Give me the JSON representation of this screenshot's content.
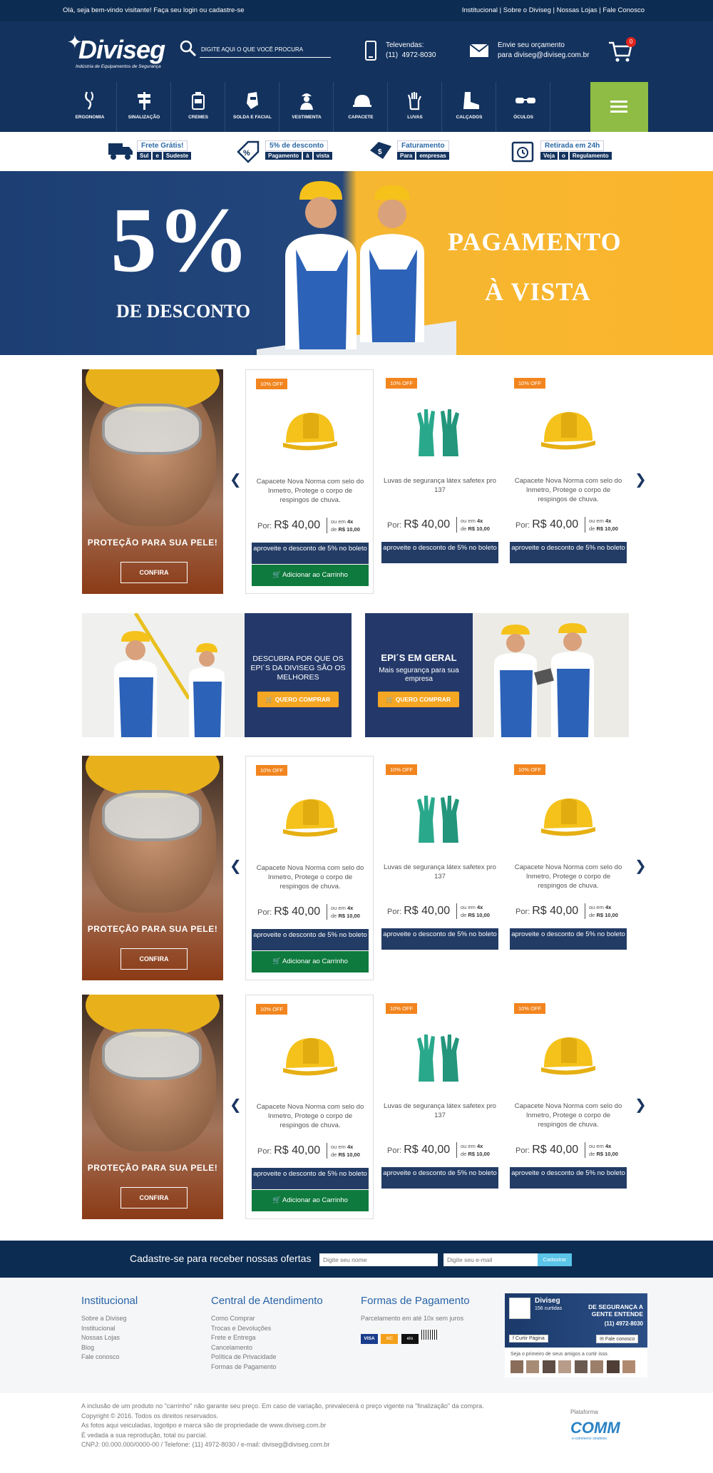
{
  "topbar": {
    "welcome": "Olá, seja bem-vindo visitante! Faça seu login ou cadastre-se",
    "links": "Institucional | Sobre o Diviseg | Nossas Lojas | Fale Conosco"
  },
  "header": {
    "brand": "Diviseg",
    "tagline": "Indústria de Equipamentos de Segurança",
    "search_placeholder": "DIGITE AQUI O QUE VOCÊ PROCURA",
    "phone_label": "Televendas:",
    "phone": "(11)  4972-8030",
    "quote_label": "Envie seu orçamento",
    "quote_email": "para diviseg@diviseg.com.br",
    "cart_count": "0",
    "icons": {
      "search": "search-icon",
      "phone": "phone-icon",
      "mail": "envelope-icon",
      "cart": "cart-icon"
    }
  },
  "categories": [
    {
      "label": "ERGONOMIA",
      "icon": "ergonomia-icon"
    },
    {
      "label": "SINALIZAÇÃO",
      "icon": "signpost-icon"
    },
    {
      "label": "CREMES",
      "icon": "cream-icon"
    },
    {
      "label": "SOLDA E FACIAL",
      "icon": "welding-mask-icon"
    },
    {
      "label": "VESTIMENTA",
      "icon": "worker-icon"
    },
    {
      "label": "CAPACETE",
      "icon": "helmet-icon"
    },
    {
      "label": "LUVAS",
      "icon": "glove-icon"
    },
    {
      "label": "CALÇADOS",
      "icon": "boot-icon"
    },
    {
      "label": "ÓCULOS",
      "icon": "glasses-icon"
    }
  ],
  "perks": [
    {
      "title": "Frete Grátis!",
      "tags": [
        "Sul",
        "e",
        "Sudeste"
      ],
      "icon": "truck-icon"
    },
    {
      "title": "5% de desconto",
      "tags": [
        "Pagamento",
        "à",
        "vista"
      ],
      "icon": "discount-tag-icon"
    },
    {
      "title": "Faturamento",
      "tags": [
        "Para",
        "empresas"
      ],
      "icon": "invoice-icon"
    },
    {
      "title": "Retirada em 24h",
      "tags": [
        "Veja",
        "o",
        "Regulamento"
      ],
      "icon": "calendar-clock-icon"
    }
  ],
  "hero": {
    "percent": "5%",
    "discount": "DE DESCONTO",
    "line1": "PAGAMENTO",
    "line2": "À VISTA",
    "colors": {
      "left": "#1c3e73",
      "right": "#fbb52d"
    }
  },
  "promo": {
    "title": "PROTEÇÃO PARA SUA PELE!",
    "button": "CONFIRA"
  },
  "products": [
    {
      "badge": "10% OFF",
      "name": "Capacete Nova Norma com selo do Inmetro, Protege o corpo de respingos de chuva.",
      "price_label": "Por:",
      "price": "R$ 40,00",
      "inst1": "ou em",
      "inst_n": "4x",
      "inst2": "de",
      "inst_val": "R$ 10,00",
      "boleto": "aproveite o desconto de 5% no boleto",
      "add": "Adicionar ao Carrinho",
      "image": "helmet-icon"
    },
    {
      "badge": "10% OFF",
      "name": "Luvas de segurança látex safetex pro 137",
      "price_label": "Por:",
      "price": "R$ 40,00",
      "inst1": "ou em",
      "inst_n": "4x",
      "inst2": "de",
      "inst_val": "R$ 10,00",
      "boleto": "aproveite o desconto de 5% no boleto",
      "image": "glove-icon"
    },
    {
      "badge": "10% OFF",
      "name": "Capacete Nova Norma com selo do Inmetro, Protege o corpo de respingos de chuva.",
      "price_label": "Por:",
      "price": "R$ 40,00",
      "inst1": "ou em",
      "inst_n": "4x",
      "inst2": "de",
      "inst_val": "R$ 10,00",
      "boleto": "aproveite o desconto de 5% no boleto",
      "image": "helmet-icon"
    }
  ],
  "banner2": {
    "left_text": "DESCUBRA POR QUE OS EPI´S DA DIVISEG SÃO OS MELHORES",
    "left_btn": "QUERO COMPRAR",
    "right_title": "EPI´S EM GERAL",
    "right_sub": "Mais segurança para sua empresa",
    "right_btn": "QUERO COMPRAR"
  },
  "newsletter": {
    "title": "Cadastre-se para receber nossas ofertas",
    "name_placeholder": "Digite seu nome",
    "email_placeholder": "Digite seu e-mail",
    "button": "Cadastrar"
  },
  "footer": {
    "institucional": {
      "title": "Institucional",
      "items": [
        "Sobre a Diviseg",
        "Institucional",
        "Nossas Lojas",
        "Blog",
        "Fale conosco"
      ]
    },
    "atendimento": {
      "title": "Central de Atendimento",
      "items": [
        "Como Comprar",
        "Trocas e Devoluções",
        "Frete e Entrega",
        "Cancelamento",
        "Política de Privacidade",
        "Formas de Pagamento"
      ]
    },
    "pagamento": {
      "title": "Formas de Pagamento",
      "text": "Parcelamento em até 10x sem juros",
      "cards": [
        "VISA",
        "MC",
        "elo",
        "boleto"
      ]
    },
    "facebook": {
      "name": "Diviseg",
      "likes": "156 curtidas",
      "like_btn": "Curtir Página",
      "contact_btn": "Fale conosco",
      "cover_text": "DE SEGURANÇA A GENTE ENTENDE",
      "cover_phone": "(11) 4972-8030",
      "friends": "Seja o primeiro de seus amigos a curtir isso."
    }
  },
  "legal": {
    "lines": [
      "A inclusão de um produto no \"carrinho\" não garante seu preço. Em caso de variação, prevalecerá o preço vigente na \"finalização\" da compra.",
      "Copyright © 2016. Todos os direitos reservados.",
      "As fotos aqui veiculadas, logotipo e marca são de propriedade de www.diviseg.com.br",
      "É vedada a sua reprodução, total ou parcial.",
      "CNPJ: 00.000.000/0000-00 / Telefone: (11) 4972-8030 / e-mail: diviseg@diviseg.com.br"
    ],
    "platform_label": "Plataforma",
    "platform": "COMM",
    "platform_sub": "e-commerce solutions"
  }
}
